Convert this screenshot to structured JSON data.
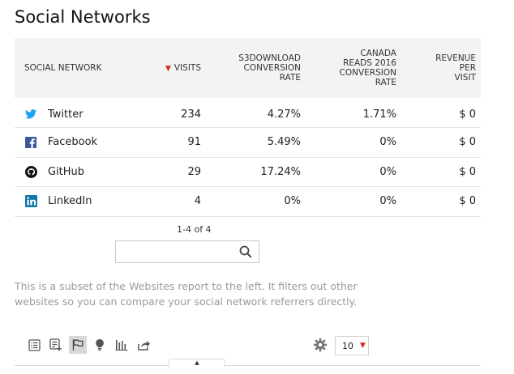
{
  "title": "Social Networks",
  "table": {
    "headers": {
      "name": "SOCIAL NETWORK",
      "visits": "VISITS",
      "s3": [
        "S3DOWNLOAD",
        "CONVERSION",
        "RATE"
      ],
      "canada": [
        "CANADA",
        "READS 2016",
        "CONVERSION",
        "RATE"
      ],
      "revenue": [
        "REVENUE",
        "PER",
        "VISIT"
      ]
    },
    "sort_indicator": "▼",
    "rows": [
      {
        "name": "Twitter",
        "icon": "twitter-icon",
        "visits": "234",
        "s3": "4.27%",
        "canada": "1.71%",
        "revenue": "$ 0"
      },
      {
        "name": "Facebook",
        "icon": "facebook-icon",
        "visits": "91",
        "s3": "5.49%",
        "canada": "0%",
        "revenue": "$ 0"
      },
      {
        "name": "GitHub",
        "icon": "github-icon",
        "visits": "29",
        "s3": "17.24%",
        "canada": "0%",
        "revenue": "$ 0"
      },
      {
        "name": "LinkedIn",
        "icon": "linkedin-icon",
        "visits": "4",
        "s3": "0%",
        "canada": "0%",
        "revenue": "$ 0"
      }
    ]
  },
  "pagination": "1-4 of 4",
  "search": {
    "value": "",
    "placeholder": ""
  },
  "note": "This is a subset of the Websites report to the left. It filters out other websites so you can compare your social network referrers directly.",
  "limit": {
    "value": "10"
  },
  "colors": {
    "accent": "#d4291f",
    "twitter": "#1da1f2",
    "facebook": "#3b5998",
    "linkedin": "#0e76a8",
    "github": "#111111"
  }
}
